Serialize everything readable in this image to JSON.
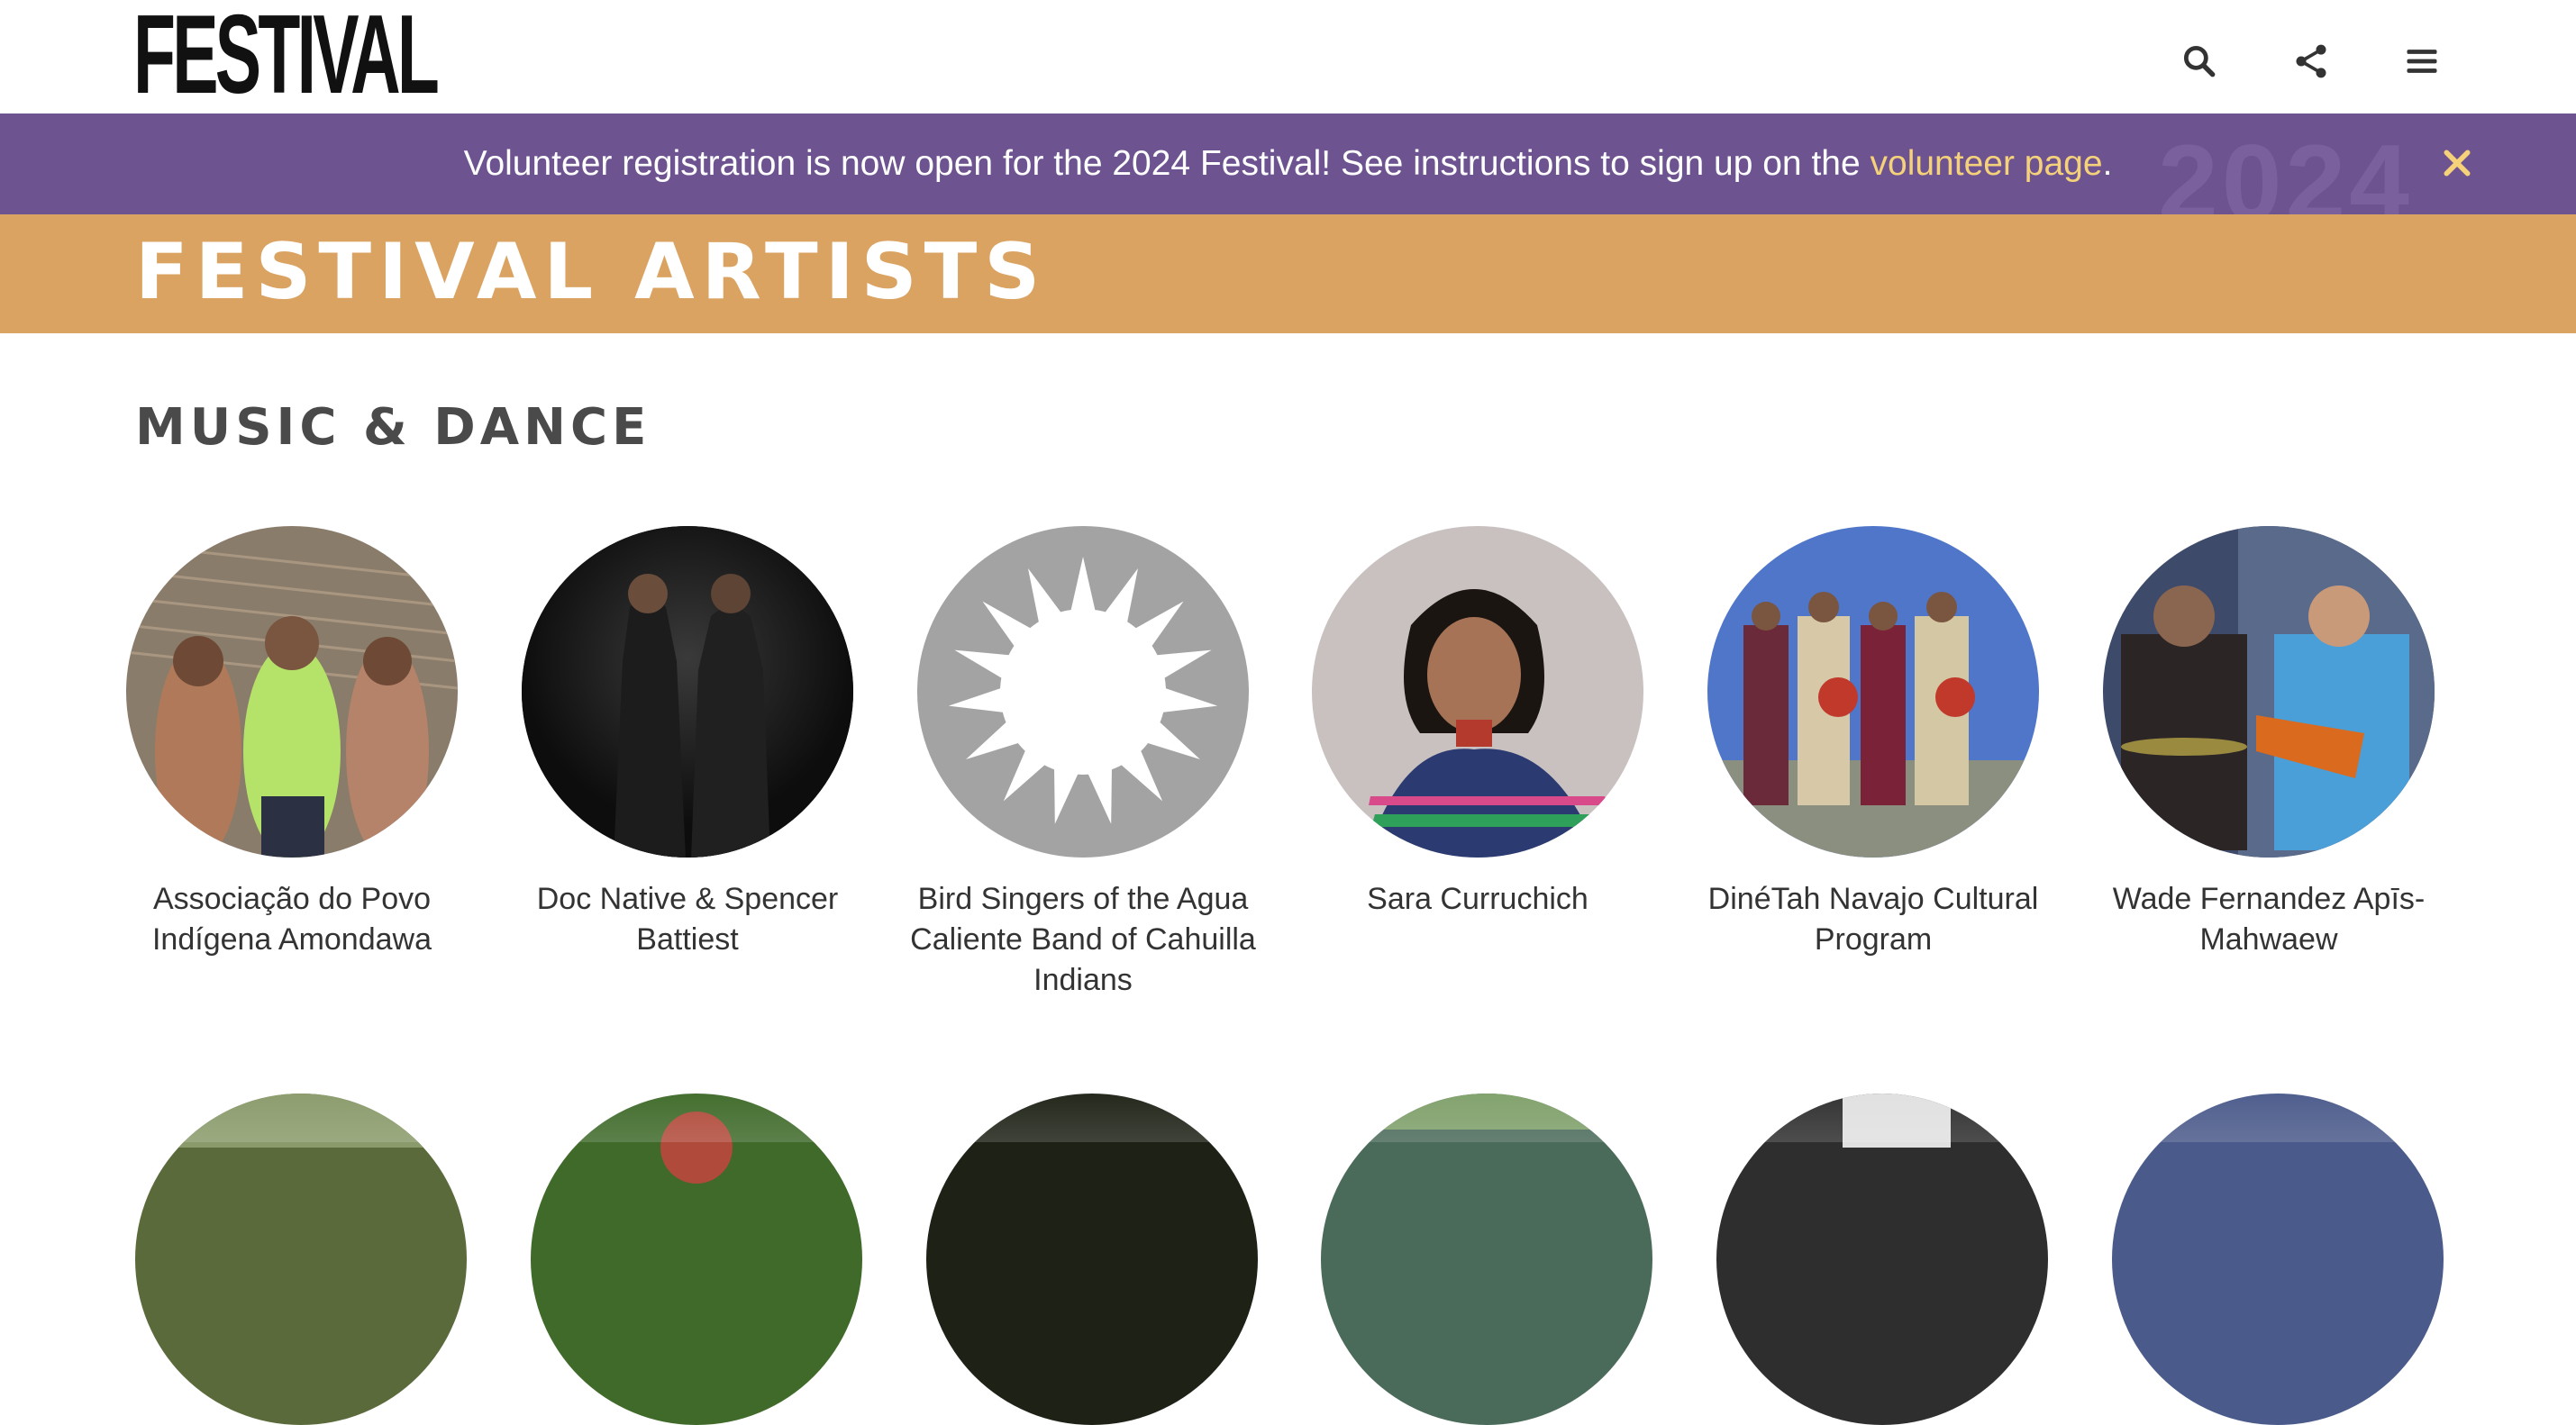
{
  "header": {
    "logo_text": "FESTIVAL",
    "icons": [
      "search-icon",
      "share-icon",
      "menu-icon"
    ]
  },
  "announcement": {
    "text_before": "Volunteer registration is now open for the 2024 Festival! See instructions to sign up on the ",
    "link_text": "volunteer page",
    "text_after": ".",
    "watermark": "2024",
    "close_icon": "close-icon",
    "link_color": "#f5d27a",
    "background": "#6e5391"
  },
  "page": {
    "title": "FESTIVAL ARTISTS",
    "band_color": "#dba362"
  },
  "section": {
    "title": "MUSIC & DANCE",
    "artists": [
      {
        "name": "Associação do Povo Indígena Amondawa"
      },
      {
        "name": "Doc Native & Spencer Battiest"
      },
      {
        "name": "Bird Singers of the Agua Caliente Band of Cahuilla Indians"
      },
      {
        "name": "Sara Curruchich"
      },
      {
        "name": "DinéTah Navajo Cultural Program"
      },
      {
        "name": "Wade Fernandez Apīs-Mahwaew"
      }
    ]
  }
}
